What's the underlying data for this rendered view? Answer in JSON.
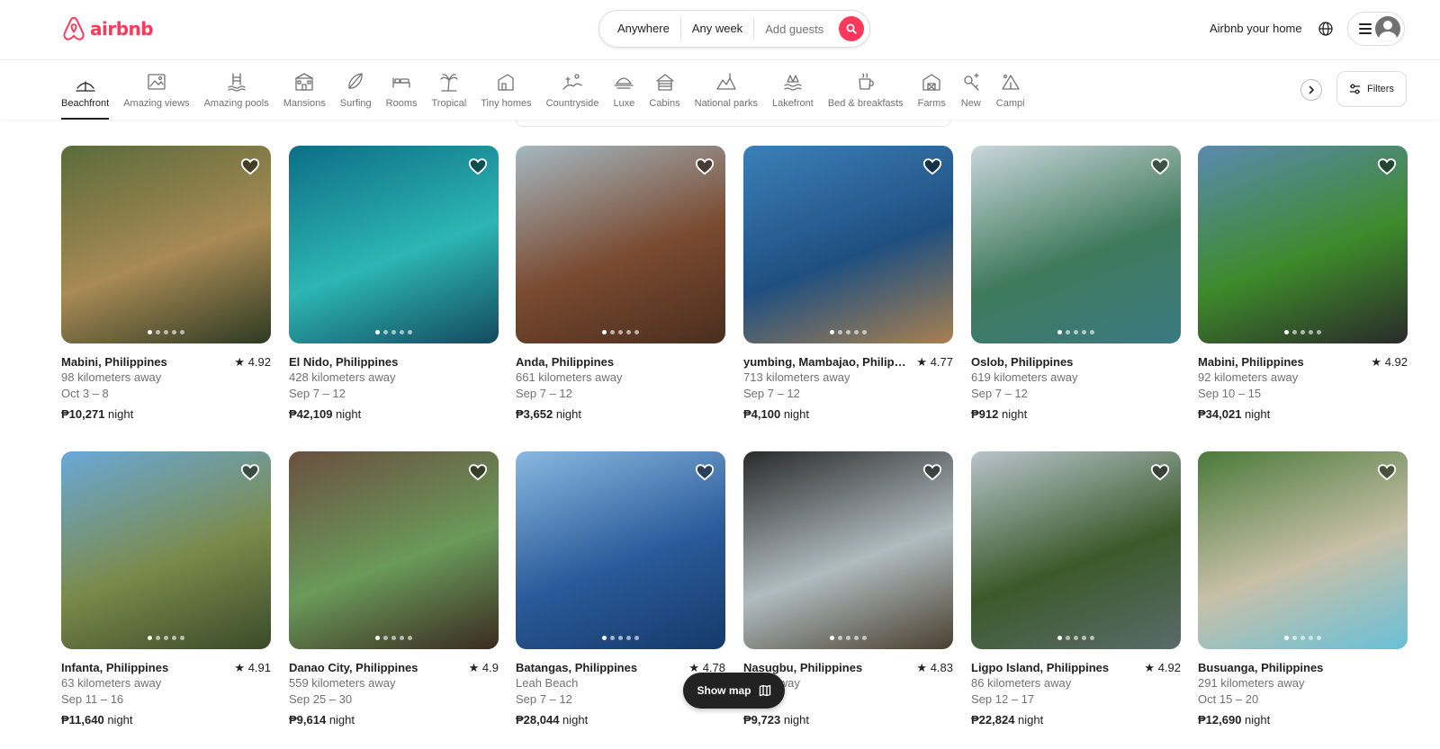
{
  "header": {
    "logo_text": "airbnb",
    "search": {
      "where": "Anywhere",
      "when": "Any week",
      "guests": "Add guests"
    },
    "host_link": "Airbnb your home"
  },
  "categories": {
    "items": [
      {
        "label": "Beachfront",
        "icon": "beach-umbrella-icon",
        "active": true
      },
      {
        "label": "Amazing views",
        "icon": "framed-view-icon"
      },
      {
        "label": "Amazing pools",
        "icon": "pool-icon"
      },
      {
        "label": "Mansions",
        "icon": "mansion-icon"
      },
      {
        "label": "Surfing",
        "icon": "surfboard-icon"
      },
      {
        "label": "Rooms",
        "icon": "bed-icon"
      },
      {
        "label": "Tropical",
        "icon": "palm-tree-icon"
      },
      {
        "label": "Tiny homes",
        "icon": "tiny-home-icon"
      },
      {
        "label": "Countryside",
        "icon": "countryside-icon"
      },
      {
        "label": "Luxe",
        "icon": "luxe-icon"
      },
      {
        "label": "Cabins",
        "icon": "cabin-icon"
      },
      {
        "label": "National parks",
        "icon": "national-park-icon"
      },
      {
        "label": "Lakefront",
        "icon": "lakefront-icon"
      },
      {
        "label": "Bed & breakfasts",
        "icon": "coffee-icon"
      },
      {
        "label": "Farms",
        "icon": "barn-icon"
      },
      {
        "label": "New",
        "icon": "sparkle-key-icon"
      },
      {
        "label": "Campi",
        "icon": "camping-icon"
      }
    ],
    "filters_label": "Filters"
  },
  "listings": [
    {
      "location": "Mabini, Philippines",
      "rating": "4.92",
      "distance": "98 kilometers away",
      "dates": "Oct 3 – 8",
      "price": "₱10,271",
      "unit": " night",
      "colors": [
        "#5a6b3a",
        "#a88a55",
        "#2e3a22"
      ]
    },
    {
      "location": "El Nido, Philippines",
      "rating": "",
      "distance": "428 kilometers away",
      "dates": "Sep 7 – 12",
      "price": "₱42,109",
      "unit": " night",
      "colors": [
        "#0d6e86",
        "#2cb6b3",
        "#134a5e"
      ]
    },
    {
      "location": "Anda, Philippines",
      "rating": "",
      "distance": "661 kilometers away",
      "dates": "Sep 7 – 12",
      "price": "₱3,652",
      "unit": " night",
      "colors": [
        "#a5b8c1",
        "#7a4a30",
        "#4a2e1e"
      ]
    },
    {
      "location": "yumbing, Mambajao, Philippi...",
      "rating": "4.77",
      "distance": "713 kilometers away",
      "dates": "Sep 7 – 12",
      "price": "₱4,100",
      "unit": " night",
      "colors": [
        "#3b7fb8",
        "#1f4f80",
        "#a88050"
      ]
    },
    {
      "location": "Oslob, Philippines",
      "rating": "",
      "distance": "619 kilometers away",
      "dates": "Sep 7 – 12",
      "price": "₱912",
      "unit": " night",
      "colors": [
        "#c9d6dc",
        "#3f7a5b",
        "#3a7a82"
      ]
    },
    {
      "location": "Mabini, Philippines",
      "rating": "4.92",
      "distance": "92 kilometers away",
      "dates": "Sep 10 – 15",
      "price": "₱34,021",
      "unit": " night",
      "colors": [
        "#5a8ab0",
        "#3d8a2a",
        "#2a2a2a"
      ]
    },
    {
      "location": "Infanta, Philippines",
      "rating": "4.91",
      "distance": "63 kilometers away",
      "dates": "Sep 11 – 16",
      "price": "₱11,640",
      "unit": " night",
      "colors": [
        "#6aa8d8",
        "#7a8a4a",
        "#3a4a2a"
      ]
    },
    {
      "location": "Danao City, Philippines",
      "rating": "4.9",
      "distance": "559 kilometers away",
      "dates": "Sep 25 – 30",
      "price": "₱9,614",
      "unit": " night",
      "colors": [
        "#6a5040",
        "#6a9a5a",
        "#3a2a20"
      ]
    },
    {
      "location": "Batangas, Philippines",
      "rating": "4.78",
      "distance": "Leah Beach",
      "dates": "Sep 7 – 12",
      "price": "₱28,044",
      "unit": " night",
      "colors": [
        "#8ab8e0",
        "#2a5a9a",
        "#163a6a"
      ]
    },
    {
      "location": "Nasugbu, Philippines",
      "rating": "4.83",
      "distance": "eters away",
      "dates": "– 15",
      "price": "₱9,723",
      "unit": " night",
      "colors": [
        "#2a2a2a",
        "#b0bcc0",
        "#4a4030"
      ]
    },
    {
      "location": "Ligpo Island, Philippines",
      "rating": "4.92",
      "distance": "86 kilometers away",
      "dates": "Sep 12 – 17",
      "price": "₱22,824",
      "unit": " night",
      "colors": [
        "#b8c4cc",
        "#3a5a2a",
        "#5a6a6a"
      ]
    },
    {
      "location": "Busuanga, Philippines",
      "rating": "",
      "distance": "291 kilometers away",
      "dates": "Oct 15 – 20",
      "price": "₱12,690",
      "unit": " night",
      "colors": [
        "#4a7a3a",
        "#c8c0a8",
        "#6ac0d8"
      ]
    }
  ],
  "show_map_label": "Show map",
  "colors": {
    "brand": "#ff385c",
    "text": "#222222",
    "muted": "#717171"
  }
}
